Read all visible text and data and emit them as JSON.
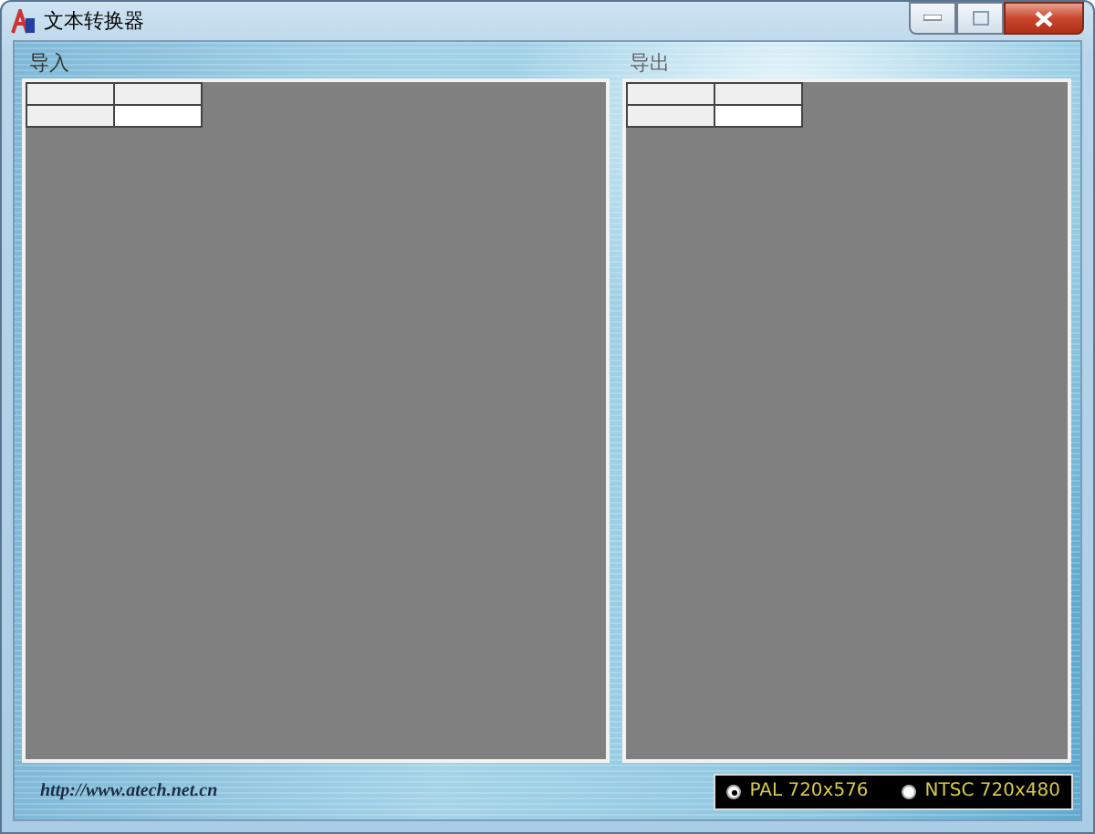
{
  "window": {
    "title": "文本转换器"
  },
  "panels": [
    {
      "label": "导入"
    },
    {
      "label": "导出"
    }
  ],
  "footer": {
    "link": "http://www.atech.net.cn"
  },
  "format_options": [
    {
      "label": "PAL 720x576",
      "selected": true
    },
    {
      "label": "NTSC 720x480",
      "selected": false
    }
  ]
}
